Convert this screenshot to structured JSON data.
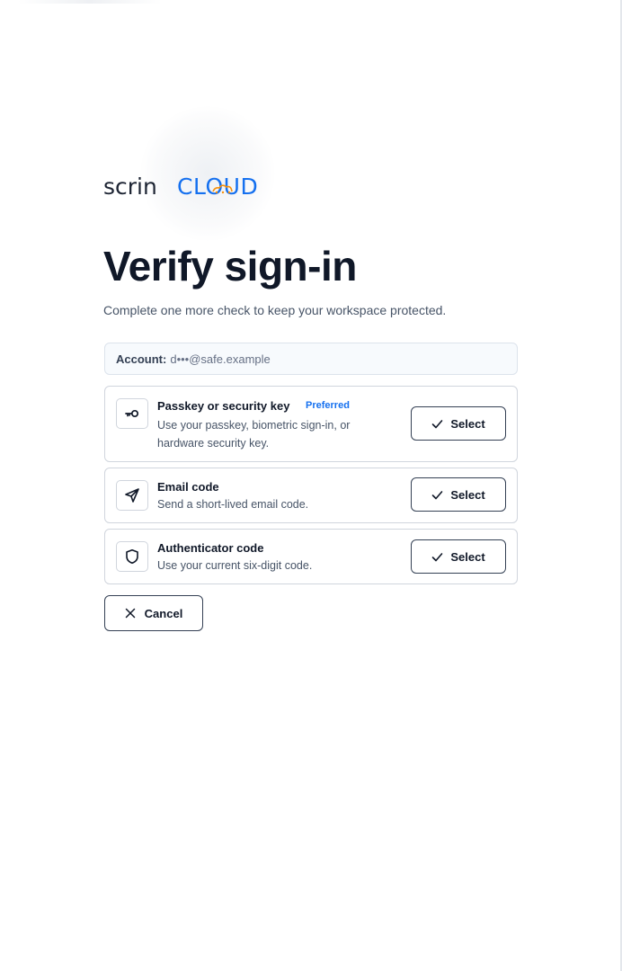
{
  "brand": {
    "logo_prefix": "scrin",
    "logo_suffix": "CLOUD",
    "colors": {
      "dark": "#1d2433",
      "accent": "#1570ef",
      "orange": "#f79009"
    }
  },
  "header": {
    "title": "Verify sign-in",
    "subtitle": "Complete one more check to keep your workspace protected."
  },
  "account": {
    "label": "Account:",
    "value": "d•••@safe.example"
  },
  "options": [
    {
      "icon": "key-icon",
      "title": "Passkey or security key",
      "badge": "Preferred",
      "description": "Use your passkey, biometric sign-in, or hardware security key.",
      "button_label": "Select"
    },
    {
      "icon": "send-icon",
      "title": "Email code",
      "description": "Send a short-lived email code.",
      "button_label": "Select"
    },
    {
      "icon": "shield-icon",
      "title": "Authenticator code",
      "description": "Use your current six-digit code.",
      "button_label": "Select"
    }
  ],
  "cancel": {
    "label": "Cancel"
  }
}
